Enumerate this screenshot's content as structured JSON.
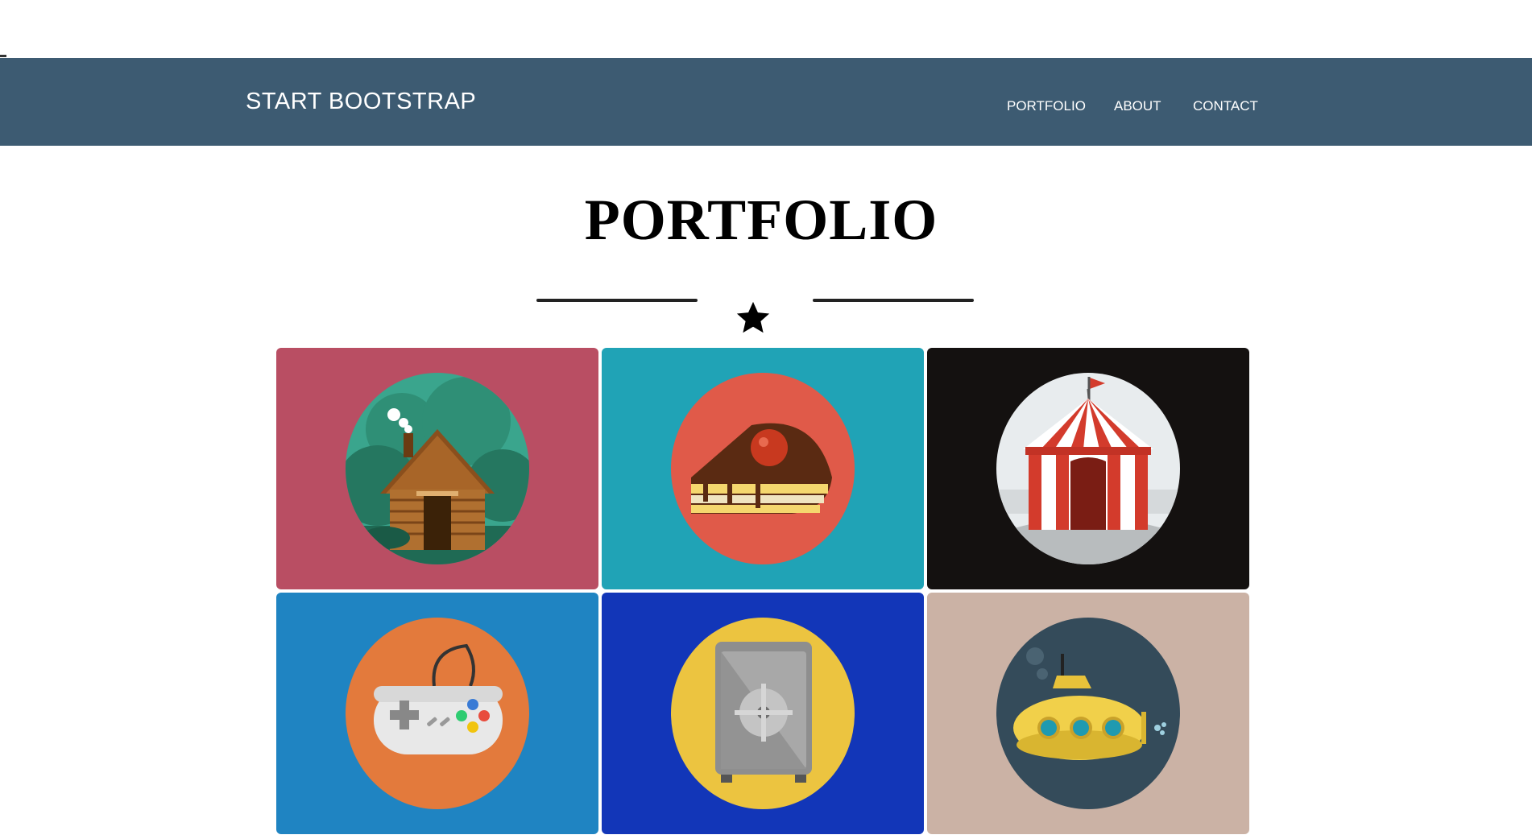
{
  "navbar": {
    "brand": "START BOOTSTRAP",
    "links": [
      "PORTFOLIO",
      "ABOUT",
      "CONTACT"
    ],
    "background": "#3d5b72"
  },
  "portfolio": {
    "title": "PORTFOLIO",
    "divider_icon": "star-icon",
    "items": [
      {
        "name": "cabin",
        "icon": "cabin-icon",
        "bg": "#b94e63",
        "circle": "#3aa58d"
      },
      {
        "name": "cake",
        "icon": "cake-icon",
        "bg": "#20a3b6",
        "circle": "#e05a49"
      },
      {
        "name": "circus",
        "icon": "circus-tent-icon",
        "bg": "#141110",
        "circle": "#e8ecee"
      },
      {
        "name": "game",
        "icon": "game-controller-icon",
        "bg": "#1f84c2",
        "circle": "#e37a3c"
      },
      {
        "name": "safe",
        "icon": "safe-icon",
        "bg": "#1236b8",
        "circle": "#ecc440"
      },
      {
        "name": "submarine",
        "icon": "submarine-icon",
        "bg": "#cbb2a5",
        "circle": "#344b5a"
      }
    ]
  }
}
